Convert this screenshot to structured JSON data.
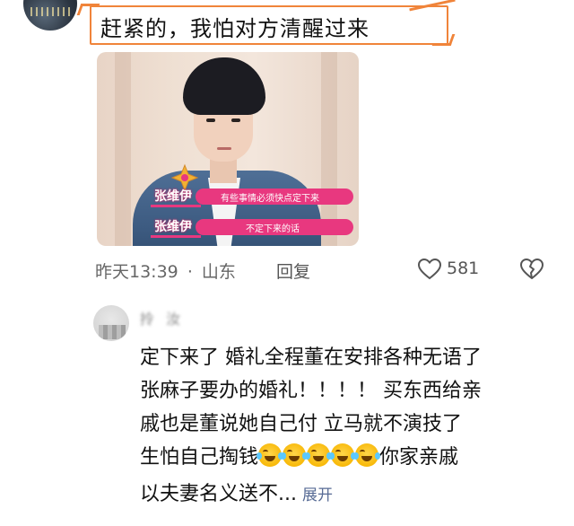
{
  "highlight": {
    "text": "赶紧的，我怕对方清醒过来"
  },
  "video": {
    "subtitles": [
      {
        "name": "张维伊",
        "text": "有些事情必须快点定下来"
      },
      {
        "name": "张维伊",
        "text": "不定下来的话"
      }
    ]
  },
  "meta": {
    "time": "昨天13:39",
    "separator": "·",
    "location": "山东",
    "reply_label": "回复",
    "like_count": "581"
  },
  "comment": {
    "username": "拎 汝",
    "lines": [
      "定下来了 婚礼全程董在安排各种无语了",
      "张麻子要办的婚礼！！！！ 买东西给亲",
      "戚也是董说她自己付 立马就不演技了",
      "生怕自己掏钱",
      "你家亲戚",
      "以夫妻名义送不..."
    ],
    "emoji_count": 5,
    "expand_label": "展开"
  }
}
